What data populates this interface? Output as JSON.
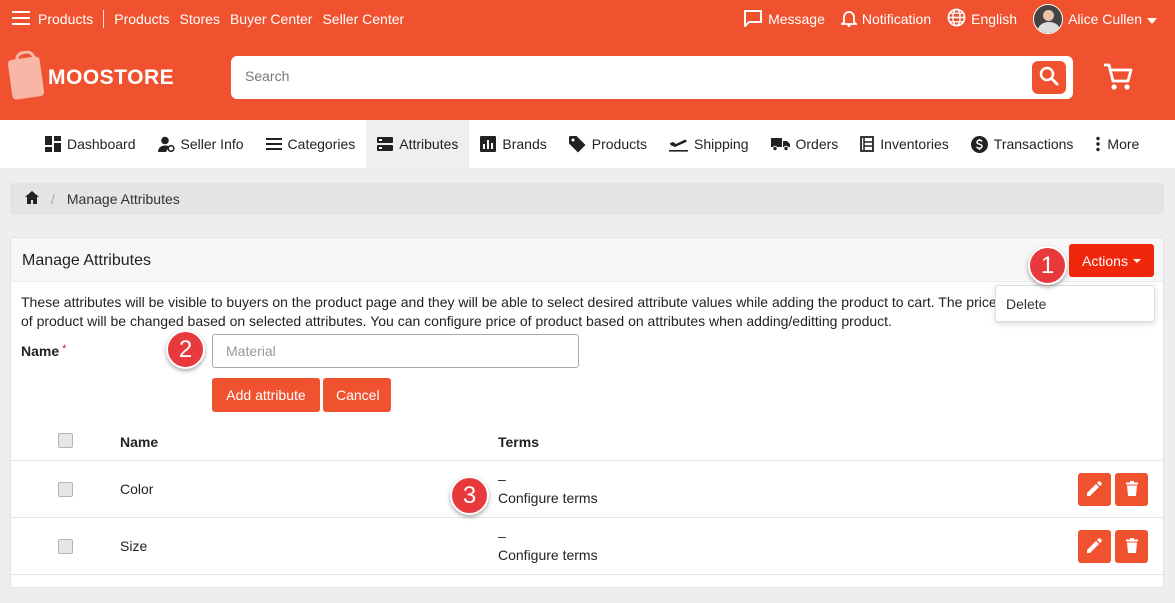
{
  "topnav": {
    "menu_label": "Products",
    "links": [
      "Products",
      "Stores",
      "Buyer Center",
      "Seller Center"
    ],
    "message": "Message",
    "notification": "Notification",
    "language": "English",
    "user": "Alice Cullen"
  },
  "brand": {
    "name": "MOOSTORE"
  },
  "search": {
    "placeholder": "Search"
  },
  "subnav": {
    "tabs": [
      "Dashboard",
      "Seller Info",
      "Categories",
      "Attributes",
      "Brands",
      "Products",
      "Shipping",
      "Orders",
      "Inventories",
      "Transactions",
      "More"
    ],
    "active": "Attributes"
  },
  "breadcrumb": {
    "current": "Manage Attributes"
  },
  "panel": {
    "title": "Manage Attributes",
    "actions_label": "Actions",
    "dropdown_option": "Delete",
    "description": "These attributes will be visible to buyers on the product page and they will be able to select desired attribute values while adding the product to cart. The price of product will be changed based on selected attributes. You can configure price of product based on attributes when adding/editting product.",
    "name_label": "Name",
    "required_mark": "*",
    "name_placeholder": "Material",
    "add_button": "Add attribute",
    "cancel_button": "Cancel"
  },
  "table": {
    "headers": {
      "name": "Name",
      "terms": "Terms"
    },
    "rows": [
      {
        "name": "Color",
        "terms_value": "–",
        "terms_link": "Configure terms"
      },
      {
        "name": "Size",
        "terms_value": "–",
        "terms_link": "Configure terms"
      }
    ]
  },
  "markers": [
    "1",
    "2",
    "3"
  ],
  "colors": {
    "brand": "#f0522f",
    "actions": "#f0270a",
    "marker": "#e8393c"
  }
}
